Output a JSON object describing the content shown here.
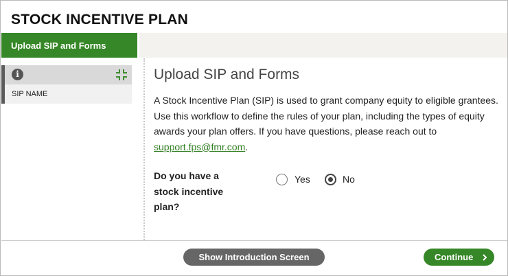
{
  "app": {
    "title": "STOCK INCENTIVE PLAN"
  },
  "tabs": [
    {
      "label": "Upload SIP and Forms",
      "active": true
    }
  ],
  "sidebar": {
    "field_label": "SIP NAME",
    "info_icon": "info-icon",
    "collapse_icon": "collapse-icon"
  },
  "main": {
    "heading": "Upload SIP and Forms",
    "description": "A Stock Incentive Plan (SIP) is used to grant company equity to eligible grantees. Use this workflow to define the rules of your plan, including the types of equity awards your plan offers. If you have questions, please reach out to ",
    "email": "support.fps@fmr.com",
    "description_end": ".",
    "question": "Do you have a stock incentive plan?",
    "options": [
      {
        "label": "Yes",
        "selected": false
      },
      {
        "label": "No",
        "selected": true
      }
    ]
  },
  "footer": {
    "intro_button": "Show Introduction Screen",
    "continue_button": "Continue"
  },
  "colors": {
    "brand_green": "#368727",
    "intro_button": "#666666",
    "link": "#2e7d1f"
  }
}
